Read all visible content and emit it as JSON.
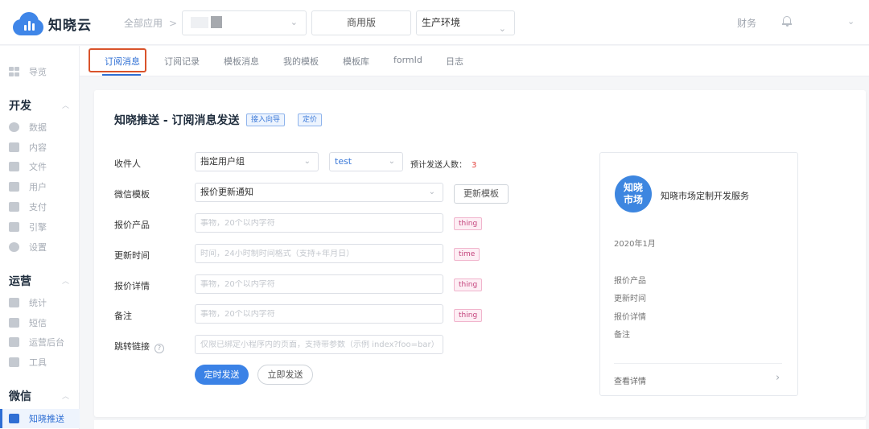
{
  "app": {
    "name": "知晓云",
    "brand_color": "#3f86e8",
    "accent": "#2f6fd4"
  },
  "header": {
    "all_apps": "全部应用",
    "edition": "商用版",
    "environment": "生产环境",
    "finance": "财务"
  },
  "sidebar": {
    "overview": "导览",
    "sections": [
      {
        "title": "开发",
        "items": [
          "数据",
          "内容",
          "文件",
          "用户",
          "支付",
          "引擎",
          "设置"
        ]
      },
      {
        "title": "运营",
        "items": [
          "统计",
          "短信",
          "运营后台",
          "工具"
        ]
      },
      {
        "title": "微信",
        "items": [
          "知晓推送"
        ]
      }
    ],
    "active_item": "知晓推送"
  },
  "tabs": [
    {
      "label": "订阅消息",
      "active": true
    },
    {
      "label": "订阅记录",
      "active": false
    },
    {
      "label": "模板消息",
      "active": false
    },
    {
      "label": "我的模板",
      "active": false
    },
    {
      "label": "模板库",
      "active": false
    },
    {
      "label": "formId",
      "active": false
    },
    {
      "label": "日志",
      "active": false
    }
  ],
  "form": {
    "title": "知晓推送 - 订阅消息发送",
    "guide_tag": "接入向导",
    "price_tag": "定价",
    "recipient_label": "收件人",
    "recipient_value": "指定用户组",
    "group_value": "test",
    "estimate_label": "预计发送人数：",
    "estimate_count": "3",
    "template_label": "微信模板",
    "template_value": "报价更新通知",
    "update_template_button": "更新模板",
    "fields": [
      {
        "label": "报价产品",
        "placeholder": "事物，20个以内字符",
        "type": "thing"
      },
      {
        "label": "更新时间",
        "placeholder": "时间，24小时制时间格式（支持+年月日）",
        "type": "time"
      },
      {
        "label": "报价详情",
        "placeholder": "事物，20个以内字符",
        "type": "thing"
      },
      {
        "label": "备注",
        "placeholder": "事物，20个以内字符",
        "type": "thing"
      }
    ],
    "link_label": "跳转链接",
    "link_help": "?",
    "link_placeholder": "仅限已绑定小程序内的页面，支持带参数（示例 index?foo=bar）",
    "scheduled_button": "定时发送",
    "send_now_button": "立即发送"
  },
  "preview": {
    "logo_text": "知晓市场",
    "logo_line1": "知晓",
    "logo_line2": "市场",
    "service_name": "知晓市场定制开发服务",
    "date": "2020年1月",
    "fields": [
      "报价产品",
      "更新时间",
      "报价详情",
      "备注"
    ],
    "view_details": "查看详情"
  }
}
